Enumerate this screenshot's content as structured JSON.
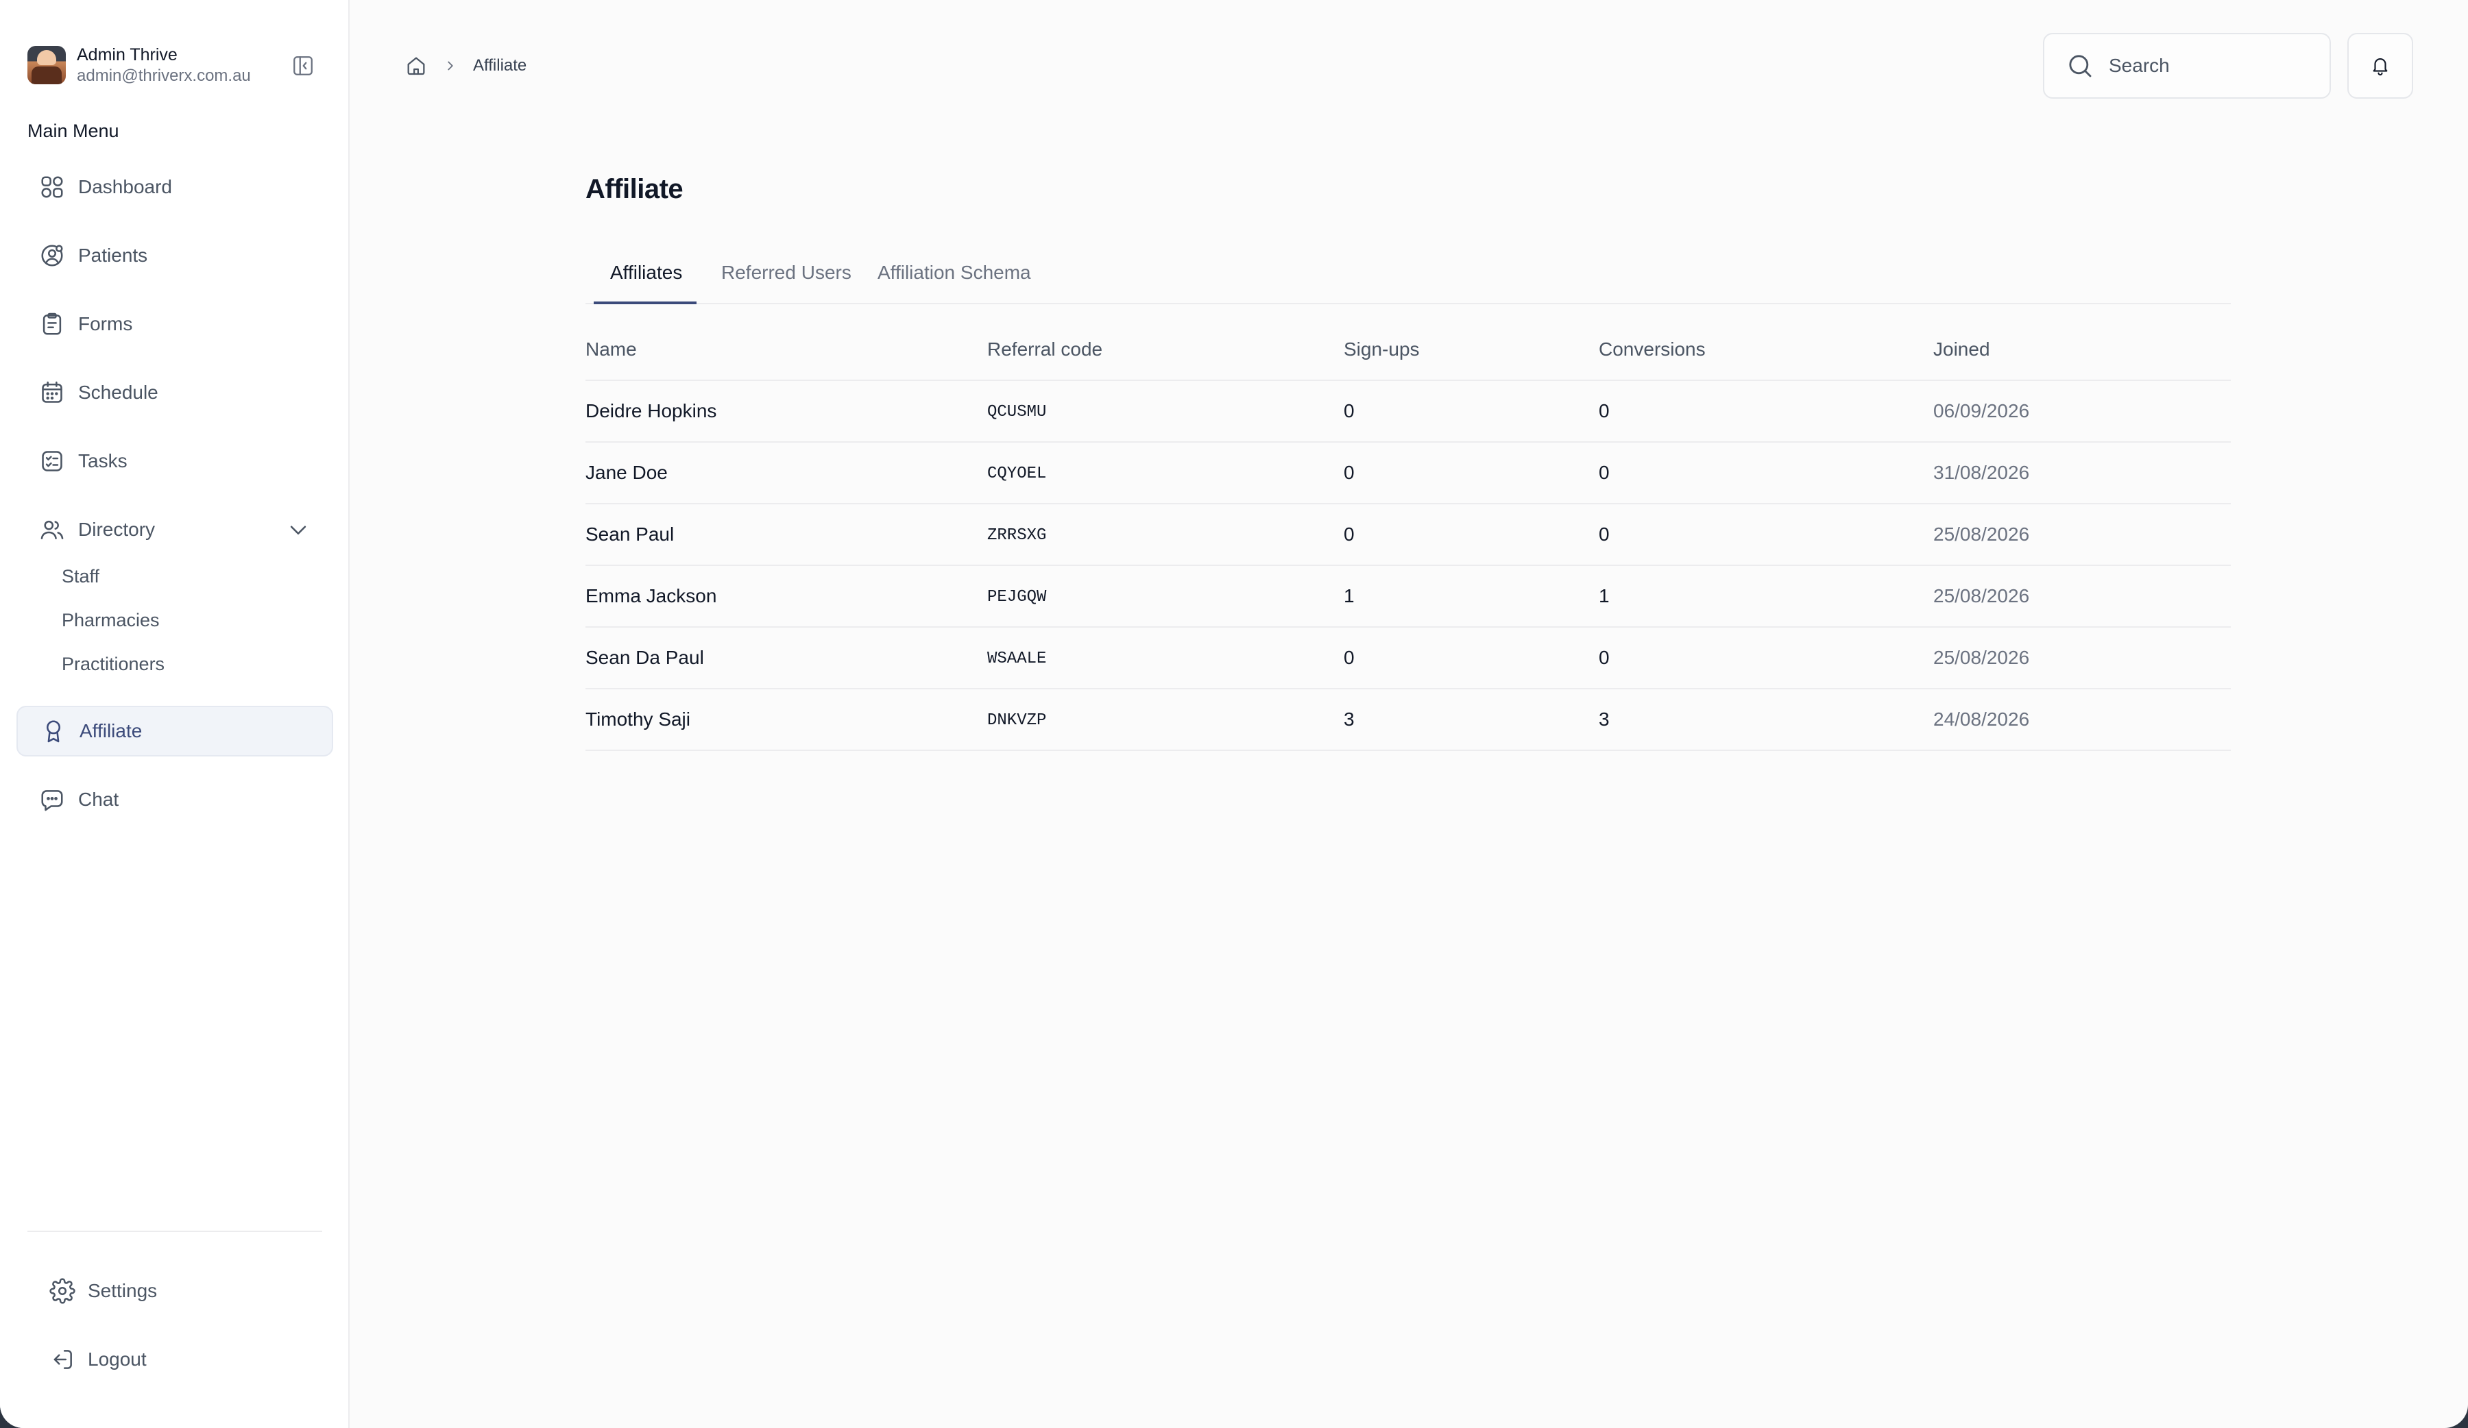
{
  "user": {
    "name": "Admin Thrive",
    "email": "admin@thriverx.com.au"
  },
  "sidebar": {
    "menu_title": "Main Menu",
    "items": [
      {
        "label": "Dashboard",
        "icon": "grid-icon"
      },
      {
        "label": "Patients",
        "icon": "user-circle-icon"
      },
      {
        "label": "Forms",
        "icon": "clipboard-icon"
      },
      {
        "label": "Schedule",
        "icon": "calendar-icon"
      },
      {
        "label": "Tasks",
        "icon": "checklist-icon"
      },
      {
        "label": "Directory",
        "icon": "users-icon"
      },
      {
        "label": "Affiliate",
        "icon": "award-icon"
      },
      {
        "label": "Chat",
        "icon": "chat-icon"
      }
    ],
    "directory_sub": [
      "Staff",
      "Pharmacies",
      "Practitioners"
    ],
    "bottom": [
      {
        "label": "Settings",
        "icon": "gear-icon"
      },
      {
        "label": "Logout",
        "icon": "logout-icon"
      }
    ]
  },
  "breadcrumb": {
    "current": "Affiliate"
  },
  "search": {
    "placeholder": "Search"
  },
  "page": {
    "title": "Affiliate"
  },
  "tabs": [
    "Affiliates",
    "Referred Users",
    "Affiliation Schema"
  ],
  "table": {
    "columns": [
      "Name",
      "Referral code",
      "Sign-ups",
      "Conversions",
      "Joined"
    ],
    "rows": [
      [
        "Deidre Hopkins",
        "QCUSMU",
        "0",
        "0",
        "06/09/2026"
      ],
      [
        "Jane Doe",
        "CQYOEL",
        "0",
        "0",
        "31/08/2026"
      ],
      [
        "Sean Paul",
        "ZRRSXG",
        "0",
        "0",
        "25/08/2026"
      ],
      [
        "Emma Jackson",
        "PEJGQW",
        "1",
        "1",
        "25/08/2026"
      ],
      [
        "Sean Da Paul",
        "WSAALE",
        "0",
        "0",
        "25/08/2026"
      ],
      [
        "Timothy Saji",
        "DNKVZP",
        "3",
        "3",
        "24/08/2026"
      ]
    ]
  },
  "colors": {
    "accent": "#3b4a7a",
    "active_bg": "#f1f4f9"
  }
}
